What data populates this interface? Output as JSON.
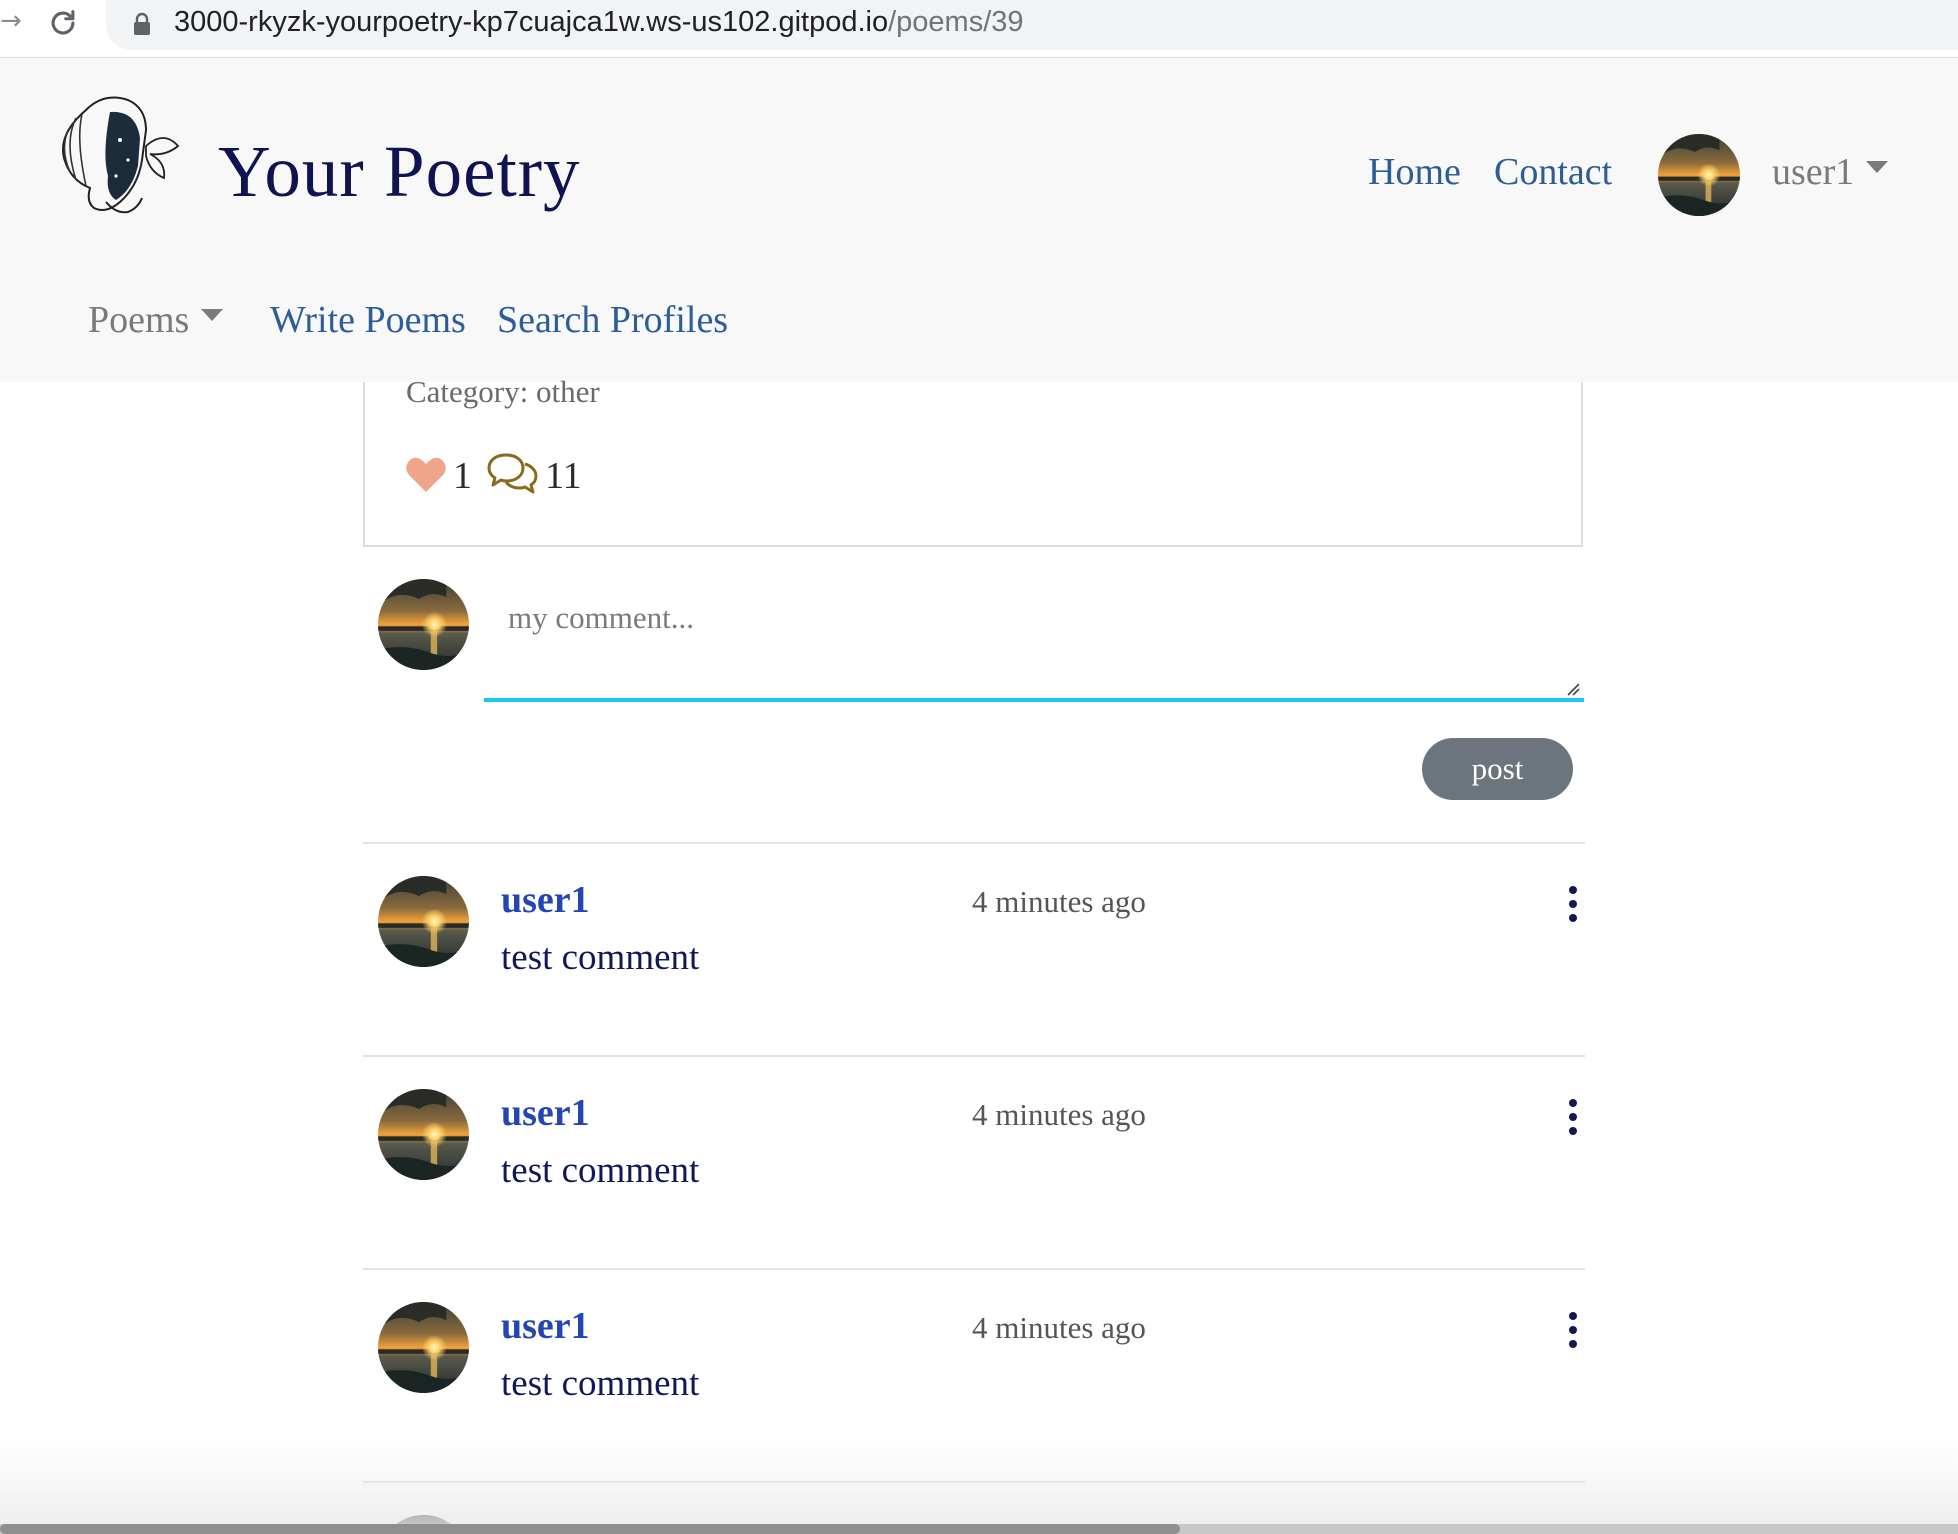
{
  "browser": {
    "url_host": "3000-rkyzk-yourpoetry-kp7cuajca1w.ws-us102.gitpod.io",
    "url_path": "/poems/39"
  },
  "header": {
    "brand": "Your Poetry",
    "nav": {
      "home": "Home",
      "contact": "Contact"
    },
    "user_menu": "user1",
    "sub_nav": {
      "poems": "Poems",
      "write": "Write Poems",
      "search": "Search Profiles"
    }
  },
  "poem": {
    "category": "Category: other",
    "likes": "1",
    "comments_count": "11"
  },
  "comment_form": {
    "placeholder": "my comment...",
    "post_label": "post"
  },
  "comments": [
    {
      "user": "user1",
      "time": "4 minutes ago",
      "text": "test comment"
    },
    {
      "user": "user1",
      "time": "4 minutes ago",
      "text": "test comment"
    },
    {
      "user": "user1",
      "time": "4 minutes ago",
      "text": "test comment"
    }
  ],
  "colors": {
    "brand": "#0f1450",
    "link": "#2c5d97",
    "comment_user": "#2346b4",
    "input_focus": "#1ec6f0",
    "post_button": "#6c757d",
    "heart": "#f0a58a",
    "comment_icon": "#8a6a1e"
  }
}
